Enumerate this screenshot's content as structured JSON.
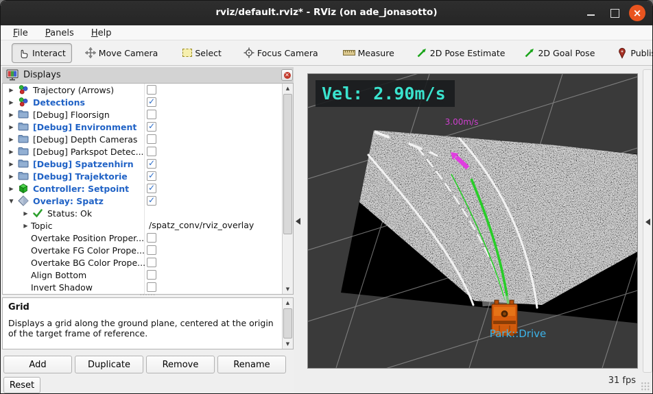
{
  "window": {
    "title": "rviz/default.rviz* - RViz (on ade_jonasotto)",
    "close_glyph": "×"
  },
  "menu_bar": {
    "items": [
      "File",
      "Panels",
      "Help"
    ]
  },
  "toolbar": {
    "tools": [
      {
        "label": "Interact",
        "icon": "hand-icon",
        "active": true
      },
      {
        "label": "Move Camera",
        "icon": "move-camera-icon",
        "active": false
      },
      {
        "label": "Select",
        "icon": "select-box-icon",
        "active": false
      },
      {
        "label": "Focus Camera",
        "icon": "focus-crosshair-icon",
        "active": false
      },
      {
        "label": "Measure",
        "icon": "ruler-icon",
        "active": false
      },
      {
        "label": "2D Pose Estimate",
        "icon": "green-arrow-icon",
        "active": false
      },
      {
        "label": "2D Goal Pose",
        "icon": "green-arrow-icon",
        "active": false
      },
      {
        "label": "Publish Point",
        "icon": "map-pin-icon",
        "active": false
      }
    ],
    "add_tool_label": "+",
    "overflow_glyph": "»"
  },
  "displays_panel": {
    "title": "Displays",
    "tree": [
      {
        "expander": "▶",
        "icon": "markers-icon",
        "label": "Trajectory (Arrows)",
        "checked": false,
        "highlight": false,
        "level": 0
      },
      {
        "expander": "▶",
        "icon": "markers-icon",
        "label": "Detections",
        "checked": true,
        "highlight": true,
        "level": 0
      },
      {
        "expander": "▶",
        "icon": "folder-icon",
        "label": "[Debug] Floorsign",
        "checked": false,
        "highlight": false,
        "level": 0
      },
      {
        "expander": "▶",
        "icon": "folder-icon",
        "label": "[Debug] Environment",
        "checked": true,
        "highlight": true,
        "level": 0
      },
      {
        "expander": "▶",
        "icon": "folder-icon",
        "label": "[Debug] Depth Cameras",
        "checked": false,
        "highlight": false,
        "level": 0
      },
      {
        "expander": "▶",
        "icon": "folder-icon",
        "label": "[Debug] Parkspot Detec...",
        "checked": false,
        "highlight": false,
        "level": 0
      },
      {
        "expander": "▶",
        "icon": "folder-icon",
        "label": "[Debug] Spatzenhirn",
        "checked": true,
        "highlight": true,
        "level": 0
      },
      {
        "expander": "▶",
        "icon": "folder-icon",
        "label": "[Debug] Trajektorie",
        "checked": true,
        "highlight": true,
        "level": 0
      },
      {
        "expander": "▶",
        "icon": "cube-icon",
        "label": "Controller: Setpoint",
        "checked": true,
        "highlight": true,
        "level": 0
      },
      {
        "expander": "▼",
        "icon": "diamond-icon",
        "label": "Overlay: Spatz",
        "checked": true,
        "highlight": true,
        "level": 0
      },
      {
        "expander": "▶",
        "icon": "check-icon",
        "label": "Status: Ok",
        "highlight": false,
        "level": 1
      },
      {
        "expander": "▶",
        "icon": null,
        "label": "Topic",
        "value": "/spatz_conv/rviz_overlay",
        "highlight": false,
        "level": 1
      },
      {
        "expander": "",
        "icon": null,
        "label": "Overtake Position Proper...",
        "checked": false,
        "highlight": false,
        "level": 1
      },
      {
        "expander": "",
        "icon": null,
        "label": "Overtake FG Color Prope...",
        "checked": false,
        "highlight": false,
        "level": 1
      },
      {
        "expander": "",
        "icon": null,
        "label": "Overtake BG Color Prope...",
        "checked": false,
        "highlight": false,
        "level": 1
      },
      {
        "expander": "",
        "icon": null,
        "label": "Align Bottom",
        "checked": false,
        "highlight": false,
        "level": 1
      },
      {
        "expander": "",
        "icon": null,
        "label": "Invert Shadow",
        "checked": false,
        "highlight": false,
        "level": 1
      }
    ],
    "splitter_dots": "······",
    "selection_info": {
      "title": "Grid",
      "text": "Displays a grid along the ground plane, centered at the origin of the target frame of reference."
    },
    "buttons": [
      "Add",
      "Duplicate",
      "Remove",
      "Rename"
    ]
  },
  "footer": {
    "reset_label": "Reset",
    "fps": "31 fps"
  },
  "viewport": {
    "vel_overlay": "Vel: 2.90m/s",
    "speed_label": "3.00m/s",
    "vehicle_label": "Park::Drive",
    "colors": {
      "velocity_text": "#3AE3CE",
      "speed_label": "#CF3FCF",
      "vehicle_label": "#3DB4EA",
      "trajectory_green": "#28CD28",
      "direction_arrow": "#E03EE0",
      "viewport_background": "#3A3A3A",
      "map_background": "#000000",
      "road_texture": "#828282",
      "grid_line": "#9C9C9C"
    }
  }
}
